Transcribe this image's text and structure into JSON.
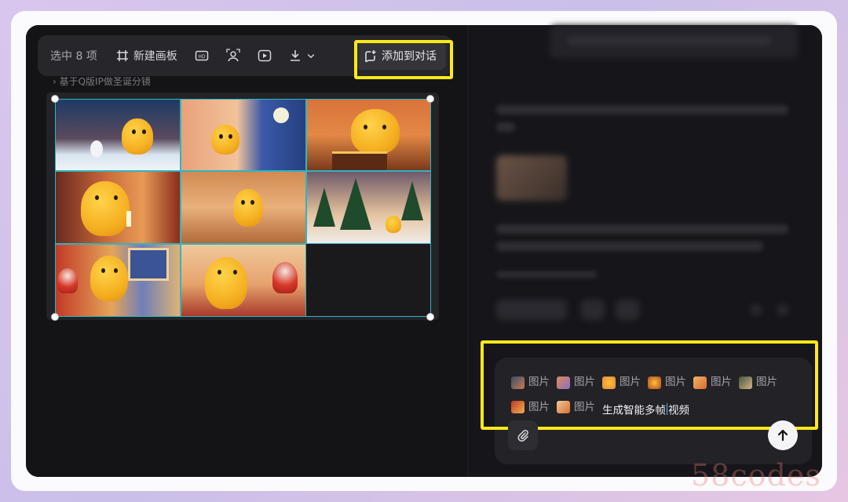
{
  "toolbar": {
    "selection_count": "选中 8 项",
    "new_board_label": "新建画板",
    "add_to_chat_label": "添加到对话"
  },
  "breadcrumb": "› 基于Q版IP做圣诞分镜",
  "composer": {
    "image_refs": [
      {
        "label": "图片",
        "color": "#c97a4a"
      },
      {
        "label": "图片",
        "color": "#8a6fc0"
      },
      {
        "label": "图片",
        "color": "#e58a3a"
      },
      {
        "label": "图片",
        "color": "#d96a2e"
      },
      {
        "label": "图片",
        "color": "#e0943e"
      },
      {
        "label": "图片",
        "color": "#7a5f48"
      },
      {
        "label": "图片",
        "color": "#d47c3c"
      },
      {
        "label": "图片",
        "color": "#e8a064"
      }
    ],
    "prompt_text_before_caret": "生成智能多帧",
    "prompt_text_after_caret": "视频"
  },
  "watermark": "58codes",
  "colors": {
    "highlight": "#ffe81a",
    "selection": "#2fb5c0"
  }
}
